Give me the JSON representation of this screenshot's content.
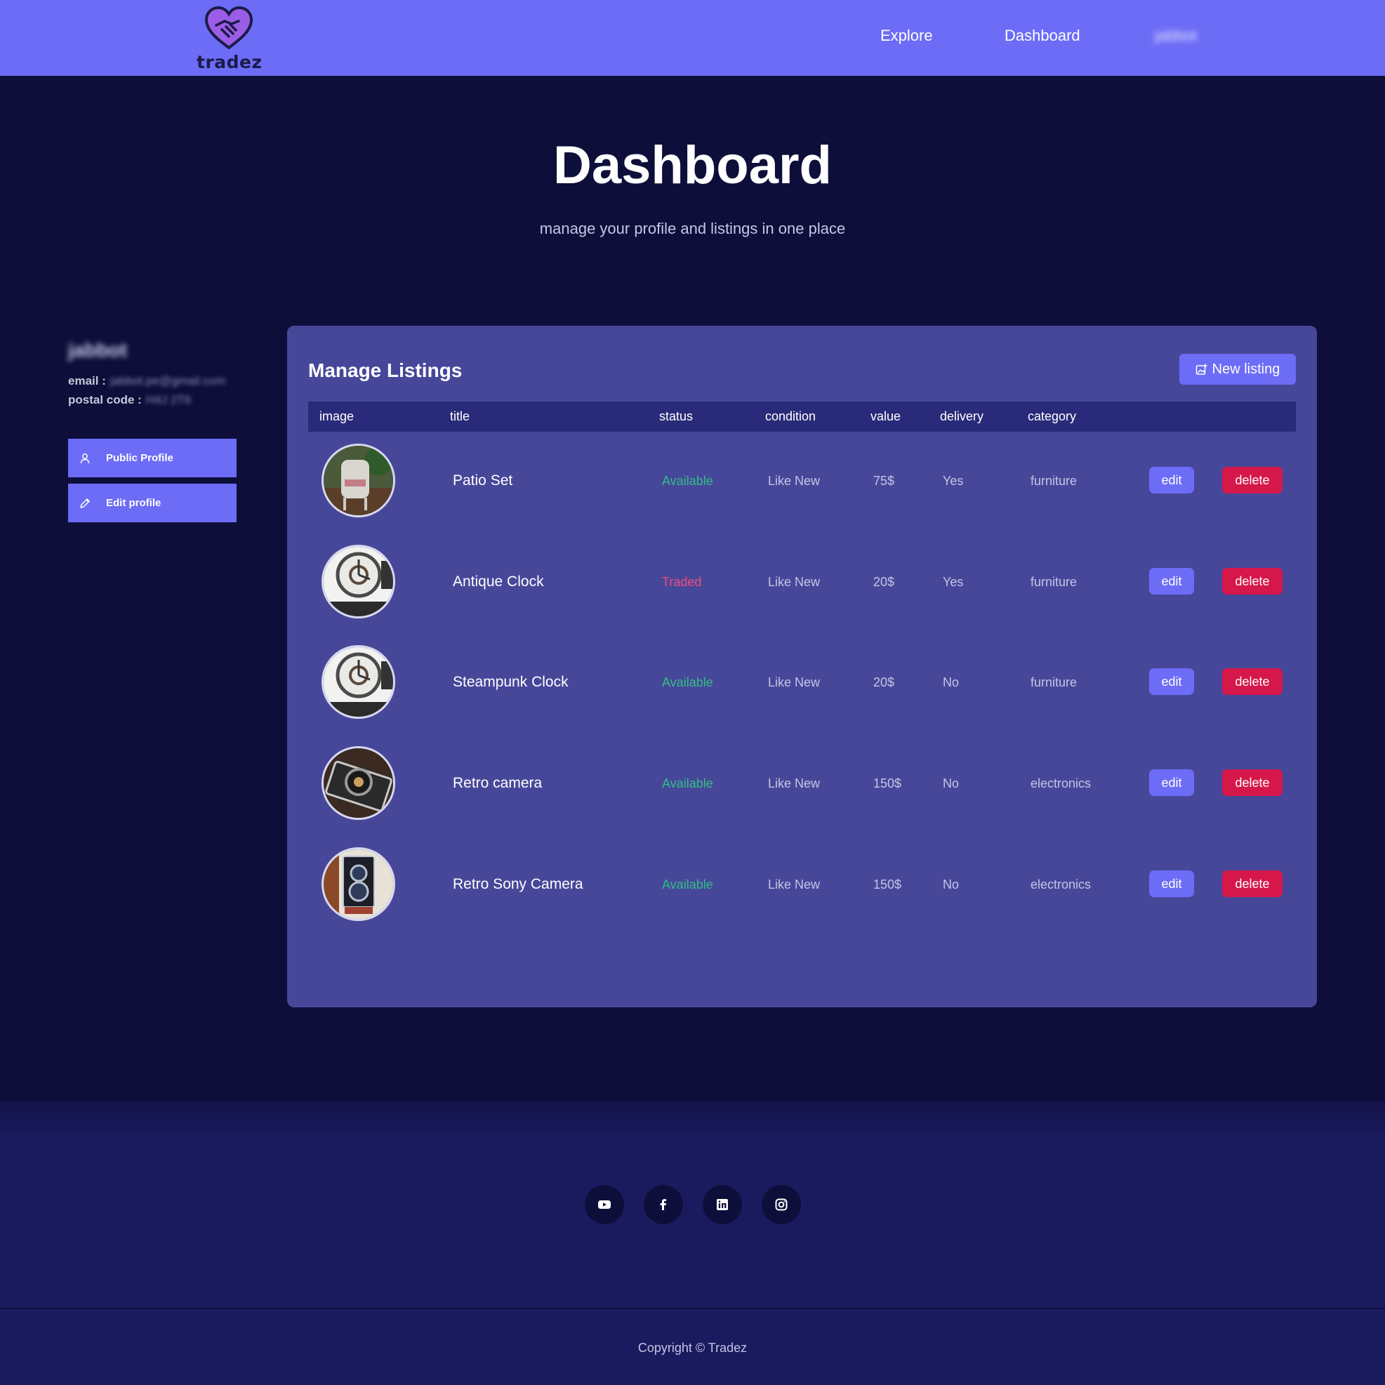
{
  "brand": {
    "name": "tradez",
    "primary": "#6c6cf7",
    "bg": "#0d0f3a",
    "card": "#47479a"
  },
  "nav": {
    "explore": "Explore",
    "dashboard": "Dashboard",
    "user": "jabbot"
  },
  "hero": {
    "title": "Dashboard",
    "subtitle": "manage your profile and listings in one place"
  },
  "profile": {
    "name": "jabbot",
    "email_label": "email :",
    "email_value": "jabbot.pe@gmail.com",
    "postal_label": "postal code :",
    "postal_value": "H4J 2T6",
    "public_profile": "Public Profile",
    "edit_profile": "Edit profile"
  },
  "listings": {
    "title": "Manage Listings",
    "new_listing": "New listing",
    "columns": [
      "image",
      "title",
      "status",
      "condition",
      "value",
      "delivery",
      "category"
    ],
    "edit_label": "edit",
    "delete_label": "delete",
    "rows": [
      {
        "image": "patio-set-photo",
        "title": "Patio Set",
        "status": "Available",
        "condition": "Like New",
        "value": "75$",
        "delivery": "Yes",
        "category": "furniture"
      },
      {
        "image": "wall-clock-photo",
        "title": "Antique Clock",
        "status": "Traded",
        "condition": "Like New",
        "value": "20$",
        "delivery": "Yes",
        "category": "furniture"
      },
      {
        "image": "wall-clock-photo",
        "title": "Steampunk Clock",
        "status": "Available",
        "condition": "Like New",
        "value": "20$",
        "delivery": "No",
        "category": "furniture"
      },
      {
        "image": "retro-camera-photo",
        "title": "Retro camera",
        "status": "Available",
        "condition": "Like New",
        "value": "150$",
        "delivery": "No",
        "category": "electronics"
      },
      {
        "image": "twin-lens-camera-photo",
        "title": "Retro Sony Camera",
        "status": "Available",
        "condition": "Like New",
        "value": "150$",
        "delivery": "No",
        "category": "electronics"
      }
    ]
  },
  "footer": {
    "socials": [
      "youtube-icon",
      "facebook-icon",
      "linkedin-icon",
      "instagram-icon"
    ],
    "copyright": "Copyright © Tradez"
  }
}
